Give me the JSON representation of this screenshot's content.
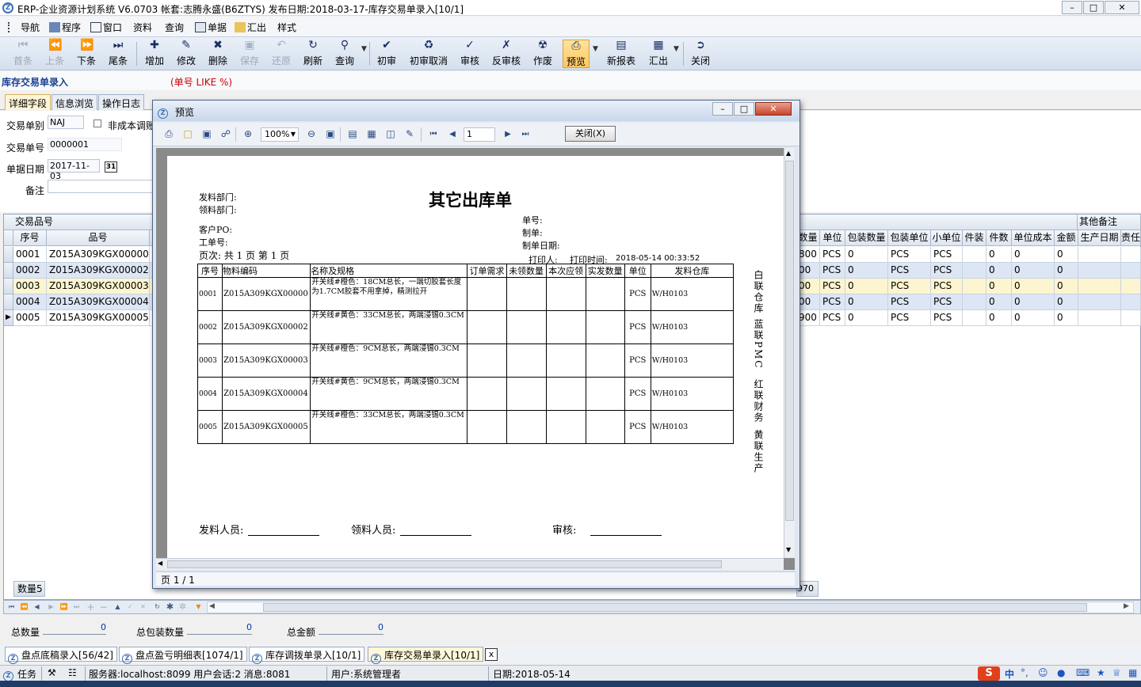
{
  "window": {
    "title": "ERP-企业资源计划系统 V6.0703 帐套:志腾永盛(B6ZTYS) 发布日期:2018-03-17-库存交易单录入[10/1]",
    "logo": "Z"
  },
  "menu": [
    "导航",
    "程序",
    "窗口",
    "资料",
    "查询",
    "单据",
    "汇出",
    "样式"
  ],
  "toolbar": {
    "first": "首条",
    "prev": "上条",
    "next": "下条",
    "last": "尾条",
    "add": "增加",
    "edit": "修改",
    "delete": "删除",
    "save": "保存",
    "undo": "还原",
    "refresh": "刷新",
    "query": "查询",
    "first_review": "初审",
    "first_review_cancel": "初审取消",
    "review": "审核",
    "unreview": "反审核",
    "void": "作废",
    "preview": "预览",
    "new_report": "新报表",
    "export": "汇出",
    "close": "关闭"
  },
  "module": {
    "title": "库存交易单录入",
    "filter": "(单号 LIKE %)"
  },
  "tabs": [
    "详细字段",
    "信息浏览",
    "操作日志"
  ],
  "form": {
    "type_label": "交易单别",
    "type_value": "NAJ",
    "noncost_label": "非成本调账",
    "no_label": "交易单号",
    "no_value": "0000001",
    "date_label": "单据日期",
    "date_value": "2017-11-03",
    "date_btn": "31",
    "remark_label": "备注"
  },
  "grid": {
    "group_left": "交易品号",
    "group_right": "其他备注",
    "headers_left": [
      "序号",
      "品号"
    ],
    "headers_right": [
      "数量",
      "单位",
      "包装数量",
      "包装单位",
      "小单位",
      "件装",
      "件数",
      "单位成本",
      "金额",
      "生产日期",
      "责任"
    ],
    "rows": [
      {
        "seq": "0001",
        "item": "Z015A309KGX00000",
        "p": "开",
        "qty": "800",
        "unit": "PCS",
        "pkg_qty": "0",
        "pkg_unit": "PCS",
        "small_unit": "PCS",
        "pieces": "0",
        "cost": "0",
        "amount": "0"
      },
      {
        "seq": "0002",
        "item": "Z015A309KGX00002",
        "p": "开",
        "qty": "00",
        "unit": "PCS",
        "pkg_qty": "0",
        "pkg_unit": "PCS",
        "small_unit": "PCS",
        "pieces": "0",
        "cost": "0",
        "amount": "0"
      },
      {
        "seq": "0003",
        "item": "Z015A309KGX00003",
        "p": "开",
        "qty": "00",
        "unit": "PCS",
        "pkg_qty": "0",
        "pkg_unit": "PCS",
        "small_unit": "PCS",
        "pieces": "0",
        "cost": "0",
        "amount": "0"
      },
      {
        "seq": "0004",
        "item": "Z015A309KGX00004",
        "p": "开",
        "qty": "00",
        "unit": "PCS",
        "pkg_qty": "0",
        "pkg_unit": "PCS",
        "small_unit": "PCS",
        "pieces": "0",
        "cost": "0",
        "amount": "0"
      },
      {
        "seq": "0005",
        "item": "Z015A309KGX00005",
        "p": "开",
        "qty": "900",
        "unit": "PCS",
        "pkg_qty": "0",
        "pkg_unit": "PCS",
        "small_unit": "PCS",
        "pieces": "0",
        "cost": "0",
        "amount": "0"
      }
    ],
    "footer_count": "数量5",
    "footer_right": "970"
  },
  "summary": {
    "total_qty_label": "总数量",
    "total_qty": "0",
    "total_pkg_label": "总包装数量",
    "total_pkg": "0",
    "total_amount_label": "总金额",
    "total_amount": "0"
  },
  "doc_tabs": [
    "盘点底稿录入[56/42]",
    "盘点盈亏明细表[1074/1]",
    "库存调拨单录入[10/1]",
    "库存交易单录入[10/1]"
  ],
  "doc_tab_close": "x",
  "status": {
    "task": "任务",
    "server": "服务器:localhost:8099 用户会话:2 消息:8081",
    "user": "用户:系统管理者",
    "date": "日期:2018-05-14"
  },
  "tray": {
    "ime": "中",
    "dot": "°,"
  },
  "preview": {
    "title": "预览",
    "zoom": "100%",
    "page_input": "1",
    "close_btn": "关闭(X)",
    "page_status": "页 1 / 1",
    "report": {
      "title": "其它出库单",
      "issue_dept": "发料部门:",
      "receive_dept": "领料部门:",
      "customer_po": "客户PO:",
      "work_no": "工单号:",
      "page_info": "页次: 共 1 页   第 1 页",
      "doc_no": "单号:",
      "maker": "制单:",
      "make_date": "制单日期:",
      "printer": "打印人:",
      "print_time_label": "打印时间:",
      "print_time": "2018-05-14 00:33:52",
      "columns": [
        "序号",
        "物料编码",
        "名称及规格",
        "订单需求",
        "未领数量",
        "本次应领",
        "实发数量",
        "单位",
        "发料仓库"
      ],
      "rows": [
        {
          "seq": "0001",
          "code": "Z015A309KGX00000",
          "spec": "开关线#橙色：18CM总长，一端切胶套长度为1.7CM胶套不用拿掉，精测拉开",
          "unit": "PCS",
          "wh": "W/H0103"
        },
        {
          "seq": "0002",
          "code": "Z015A309KGX00002",
          "spec": "开关线#黄色：33CM总长，两端浸锡0.3CM",
          "unit": "PCS",
          "wh": "W/H0103"
        },
        {
          "seq": "0003",
          "code": "Z015A309KGX00003",
          "spec": "开关线#橙色：9CM总长，两端浸锡0.3CM",
          "unit": "PCS",
          "wh": "W/H0103"
        },
        {
          "seq": "0004",
          "code": "Z015A309KGX00004",
          "spec": "开关线#黄色：9CM总长，两端浸锡0.3CM",
          "unit": "PCS",
          "wh": "W/H0103"
        },
        {
          "seq": "0005",
          "code": "Z015A309KGX00005",
          "spec": "开关线#橙色：33CM总长，两端浸锡0.3CM",
          "unit": "PCS",
          "wh": "W/H0103"
        }
      ],
      "side_notes": [
        "白联仓库",
        "蓝联PMC",
        "红联财务",
        "黄联生产"
      ],
      "sign_issuer": "发料人员:",
      "sign_receiver": "领料人员:",
      "sign_auditor": "审核:"
    }
  }
}
